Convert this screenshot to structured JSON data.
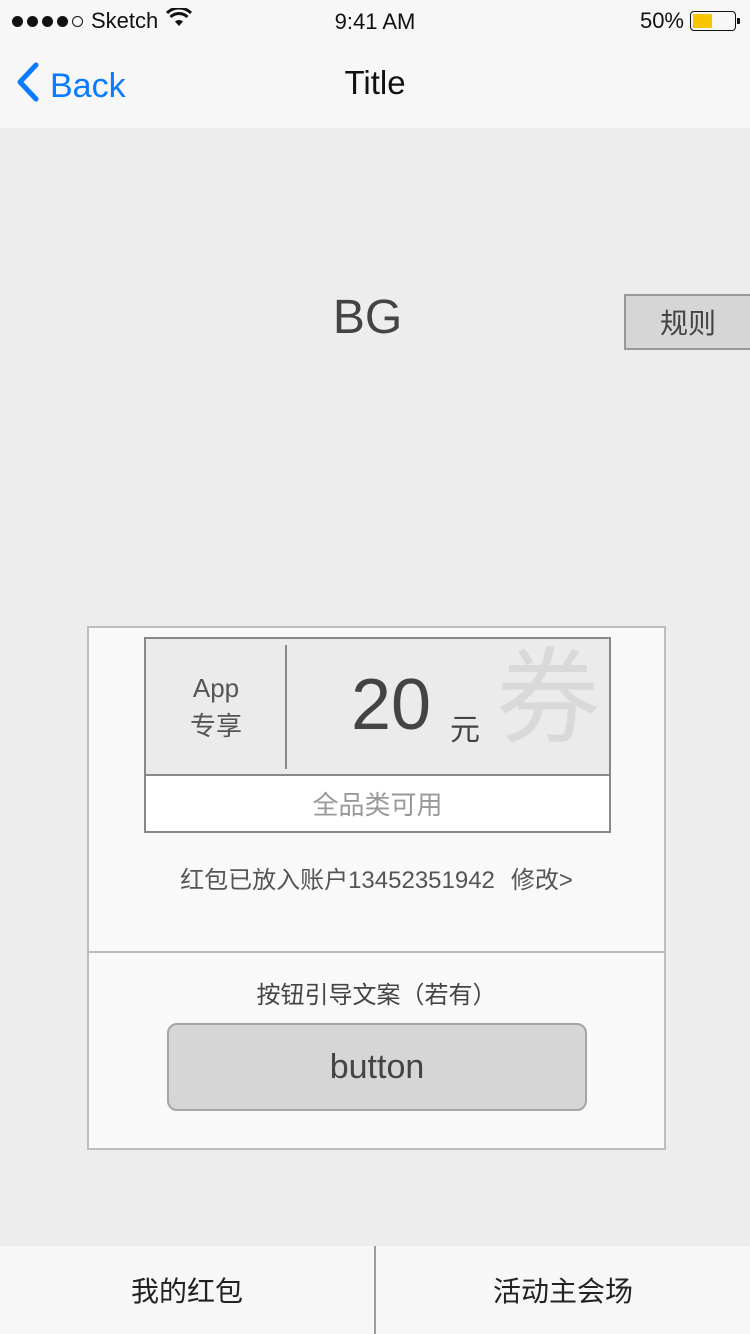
{
  "status_bar": {
    "carrier": "Sketch",
    "time": "9:41 AM",
    "battery_percent": "50%",
    "battery_level": 0.5,
    "signal_bars": 4,
    "battery_color": "#f7c600"
  },
  "nav": {
    "back_label": "Back",
    "title": "Title",
    "accent_color": "#0a7aff"
  },
  "hero": {
    "bg_label": "BG",
    "rule_label": "规则"
  },
  "coupon": {
    "tag_line1": "App",
    "tag_line2": "专享",
    "amount": "20",
    "unit": "元",
    "watermark": "券",
    "scope": "全品类可用"
  },
  "account": {
    "text": "红包已放入账户13452351942",
    "modify_label": "修改>"
  },
  "cta": {
    "guide_text": "按钮引导文案（若有）",
    "button_label": "button"
  },
  "tabbar": {
    "tabs": [
      {
        "label": "我的红包"
      },
      {
        "label": "活动主会场"
      }
    ]
  }
}
